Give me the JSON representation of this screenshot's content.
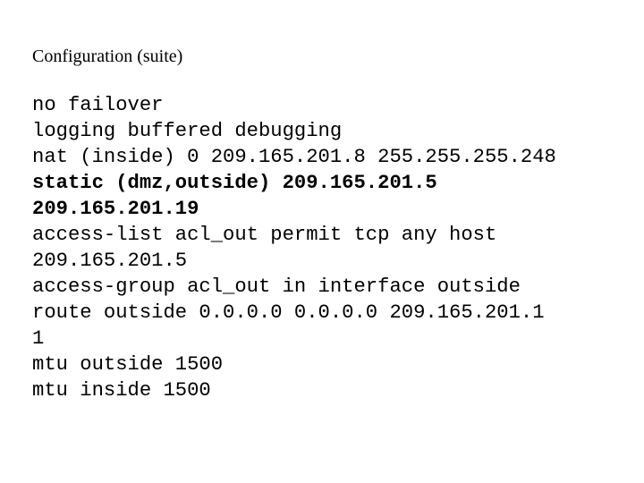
{
  "slide": {
    "title": "Configuration (suite)",
    "background_color": "#ffffff",
    "text_color": "#000000",
    "config_lines": [
      {
        "text": "no failover",
        "bold": false
      },
      {
        "text": "logging buffered debugging",
        "bold": false
      },
      {
        "text": "nat (inside) 0 209.165.201.8 255.255.255.248",
        "bold": false
      },
      {
        "text": "static (dmz,outside) 209.165.201.5",
        "bold": true
      },
      {
        "text": "209.165.201.19",
        "bold": true
      },
      {
        "text": "access-list acl_out permit tcp any host",
        "bold": false
      },
      {
        "text": "209.165.201.5",
        "bold": false
      },
      {
        "text": "access-group acl_out in interface outside",
        "bold": false
      },
      {
        "text": "route outside 0.0.0.0 0.0.0.0 209.165.201.1",
        "bold": false
      },
      {
        "text": "1",
        "bold": false
      },
      {
        "text": "mtu outside 1500",
        "bold": false
      },
      {
        "text": "mtu inside 1500",
        "bold": false
      }
    ]
  }
}
